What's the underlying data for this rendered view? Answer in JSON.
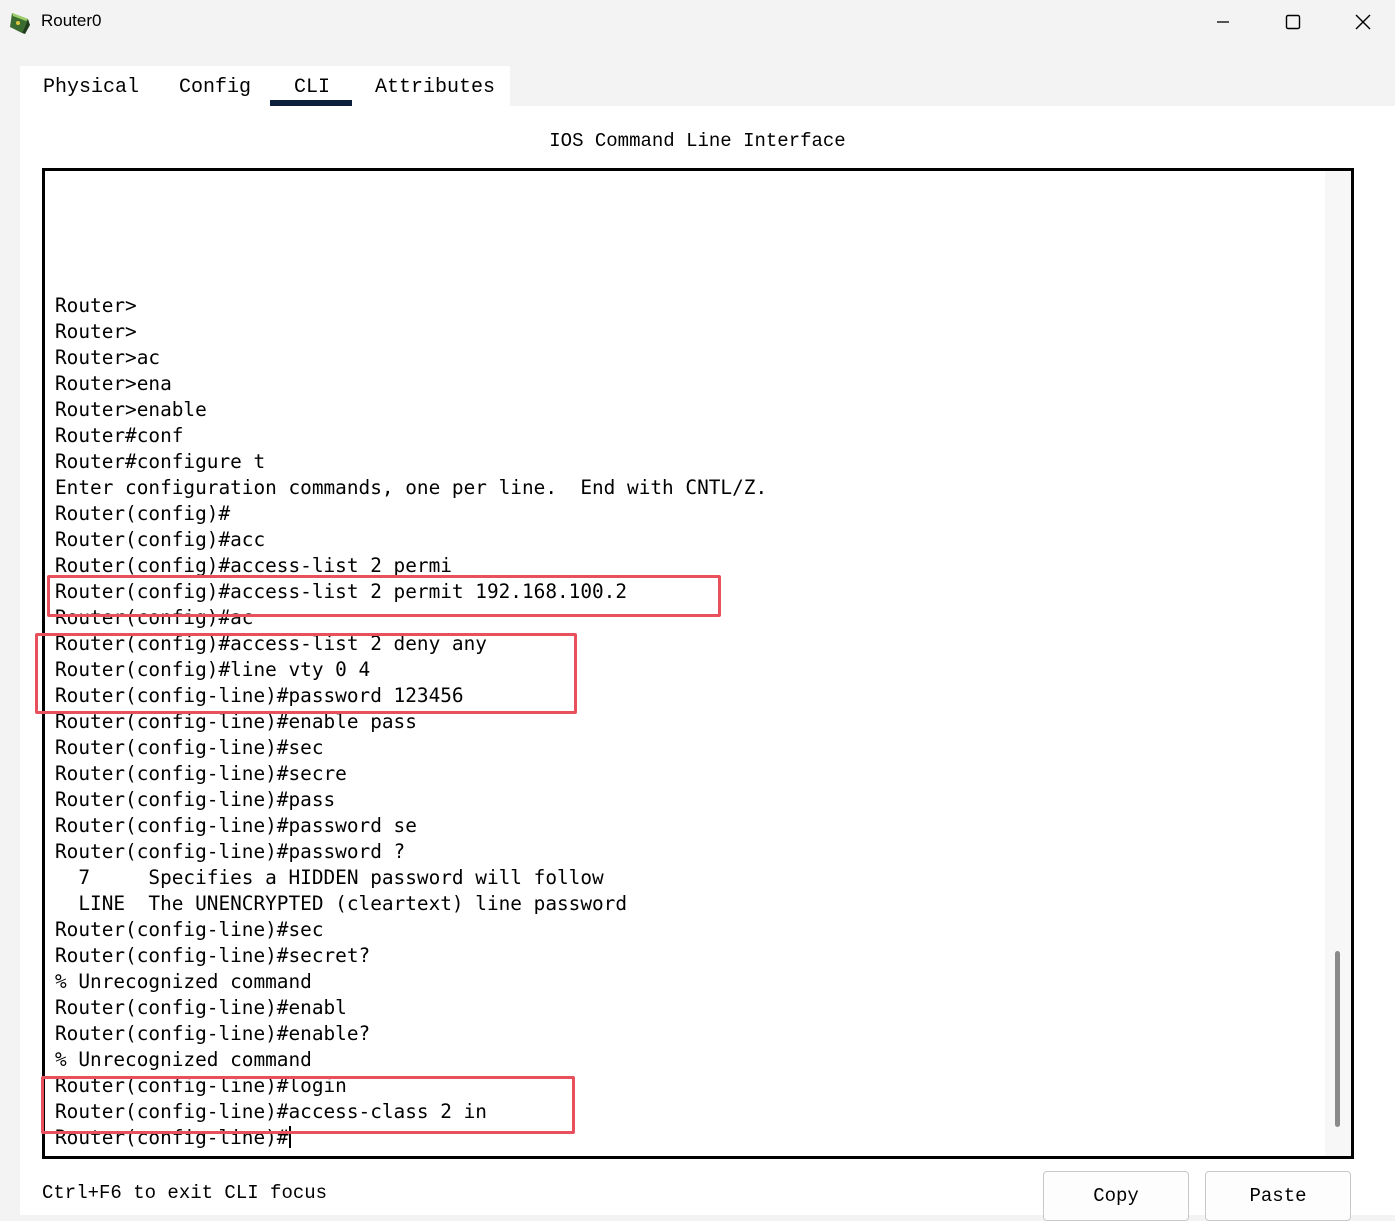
{
  "window": {
    "title": "Router0",
    "icon": "router-device-icon",
    "controls": [
      "minimize-icon",
      "maximize-icon",
      "close-icon"
    ]
  },
  "tabs": [
    {
      "label": "Physical",
      "active": false
    },
    {
      "label": "Config",
      "active": false
    },
    {
      "label": "CLI",
      "active": true
    },
    {
      "label": "Attributes",
      "active": false
    }
  ],
  "cli": {
    "heading": "IOS Command Line Interface",
    "lines": [
      "Router>",
      "Router>",
      "Router>ac",
      "Router>ena",
      "Router>enable",
      "Router#conf",
      "Router#configure t",
      "Enter configuration commands, one per line.  End with CNTL/Z.",
      "Router(config)#",
      "Router(config)#acc",
      "Router(config)#access-list 2 permi",
      "Router(config)#access-list 2 permit 192.168.100.2",
      "Router(config)#ac",
      "Router(config)#access-list 2 deny any",
      "Router(config)#line vty 0 4",
      "Router(config-line)#password 123456",
      "Router(config-line)#enable pass",
      "Router(config-line)#sec",
      "Router(config-line)#secre",
      "Router(config-line)#pass",
      "Router(config-line)#password se",
      "Router(config-line)#password ?",
      "  7     Specifies a HIDDEN password will follow",
      "  LINE  The UNENCRYPTED (cleartext) line password",
      "Router(config-line)#sec",
      "Router(config-line)#secret?",
      "% Unrecognized command",
      "Router(config-line)#enabl",
      "Router(config-line)#enable?",
      "% Unrecognized command",
      "Router(config-line)#login",
      "Router(config-line)#access-class 2 in",
      "Router(config-line)#"
    ],
    "highlight_color": "#e8505b"
  },
  "footer": {
    "hint": "Ctrl+F6 to exit CLI focus",
    "copy_label": "Copy",
    "paste_label": "Paste"
  },
  "colors": {
    "tab_underline": "#0c1f3d",
    "terminal_border": "#000000"
  }
}
